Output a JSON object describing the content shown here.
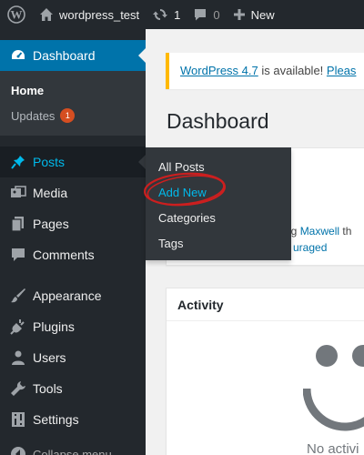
{
  "adminbar": {
    "site_name": "wordpress_test",
    "updates_count": "1",
    "comments_count": "0",
    "new_label": "New"
  },
  "sidebar": {
    "dashboard_label": "Dashboard",
    "home_label": "Home",
    "updates_label": "Updates",
    "updates_badge": "1",
    "posts_label": "Posts",
    "media_label": "Media",
    "pages_label": "Pages",
    "comments_label": "Comments",
    "appearance_label": "Appearance",
    "plugins_label": "Plugins",
    "users_label": "Users",
    "tools_label": "Tools",
    "settings_label": "Settings",
    "collapse_label": "Collapse menu"
  },
  "flyout": {
    "items": [
      "All Posts",
      "Add New",
      "Categories",
      "Tags"
    ]
  },
  "main": {
    "notice_link": "WordPress 4.7",
    "notice_text": " is available! ",
    "notice_link2": "Pleas",
    "page_title": "Dashboard",
    "welcome_text_prefix": "ng ",
    "welcome_link": "Maxwell",
    "welcome_text_suffix": " th",
    "welcome_link2": "uraged",
    "activity_title": "Activity",
    "empty_text": "No activi"
  },
  "colors": {
    "adminbar_bg": "#23282d",
    "accent_blue": "#0073aa",
    "highlight": "#00b9eb",
    "badge_orange": "#d54e21",
    "notice_yellow": "#ffb900",
    "annotation_red": "#cc1f1f"
  }
}
